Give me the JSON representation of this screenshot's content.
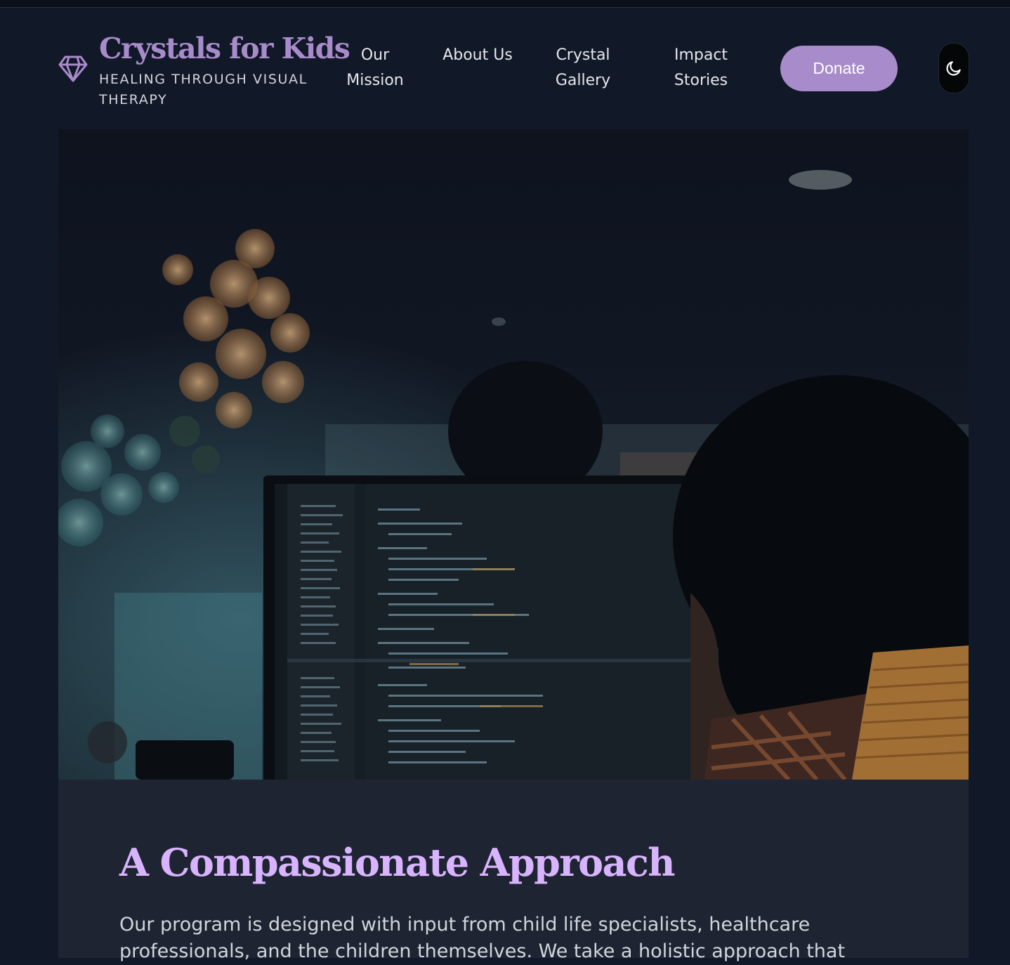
{
  "brand": {
    "title": "Crystals for Kids",
    "subtitle": "Healing Through Visual Therapy",
    "icon": "gem-icon"
  },
  "nav": {
    "items": [
      {
        "label": "Our Mission"
      },
      {
        "label": "About Us"
      },
      {
        "label": "Crystal Gallery"
      },
      {
        "label": "Impact Stories"
      }
    ],
    "donate_label": "Donate",
    "theme_toggle_icon": "moon-icon"
  },
  "hero": {
    "image_description": "Person viewing code on a computer monitor in a dim office with plants"
  },
  "section": {
    "heading": "A Compassionate Approach",
    "body": "Our program is designed with input from child life specialists, healthcare professionals, and the children themselves. We take a holistic approach that"
  },
  "colors": {
    "background": "#111827",
    "accent": "#a78bca",
    "heading": "#d8b4fe",
    "card": "#1f2433",
    "text": "#d1d5db"
  }
}
